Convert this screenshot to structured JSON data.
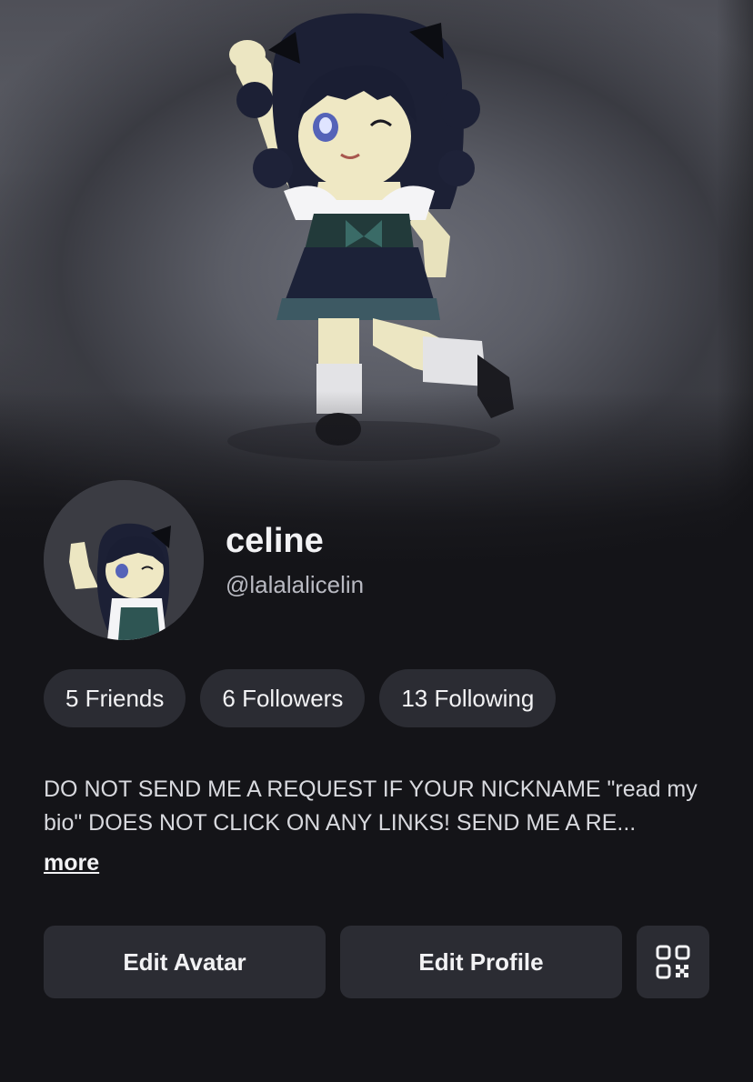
{
  "profile": {
    "display_name": "celine",
    "username": "@lalalalicelin"
  },
  "stats": {
    "friends": "5 Friends",
    "followers": "6 Followers",
    "following": "13 Following"
  },
  "bio": {
    "text": "DO NOT SEND ME A REQUEST IF YOUR NICKNAME \"read my bio\" DOES NOT CLICK ON ANY LINKS! SEND ME A RE...",
    "more_label": "more"
  },
  "actions": {
    "edit_avatar": "Edit Avatar",
    "edit_profile": "Edit Profile",
    "qr_icon": "qr-code-icon"
  },
  "colors": {
    "background": "#141418",
    "button_bg": "#2b2c33",
    "text_primary": "#f2f2f4",
    "text_secondary": "#b9bac2"
  }
}
